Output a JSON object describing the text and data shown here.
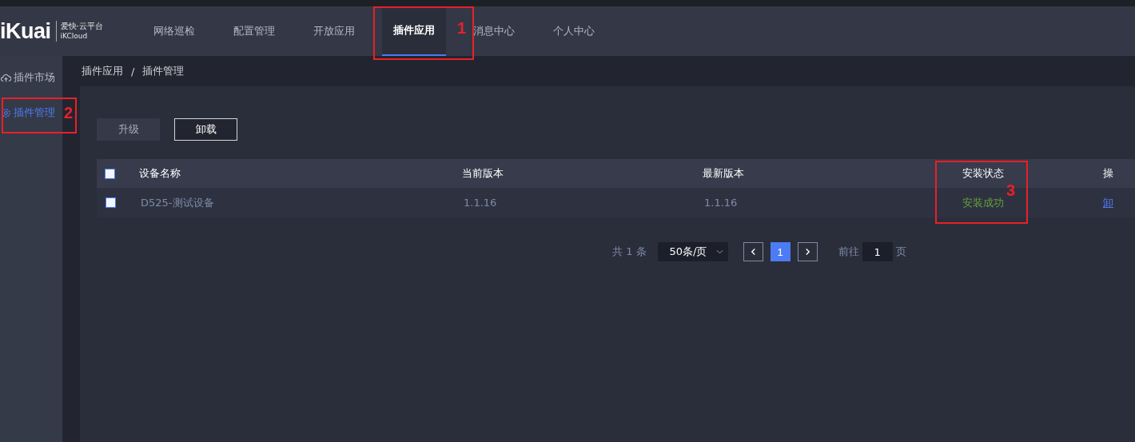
{
  "logo": {
    "brand": "iKuai",
    "subtitle": "爱快·云平台",
    "sub_en": "iKCloud"
  },
  "nav": [
    {
      "label": "网络巡检",
      "selected": false
    },
    {
      "label": "配置管理",
      "selected": false
    },
    {
      "label": "开放应用",
      "selected": false
    },
    {
      "label": "插件应用",
      "selected": true
    },
    {
      "label": "消息中心",
      "selected": false
    },
    {
      "label": "个人中心",
      "selected": false
    }
  ],
  "sidebar": [
    {
      "label": "插件市场",
      "selected": false
    },
    {
      "label": "插件管理",
      "selected": true
    }
  ],
  "breadcrumb": [
    "插件应用",
    "插件管理"
  ],
  "breadcrumb_separator": "/",
  "actions": [
    {
      "label": "升级",
      "kind": "filled"
    },
    {
      "label": "卸载",
      "kind": "outline"
    }
  ],
  "table": {
    "select_all_checked": false,
    "columns": [
      "设备名称",
      "当前版本",
      "最新版本",
      "安装状态",
      "操"
    ],
    "rows": [
      {
        "checked": false,
        "name": "D525-测试设备",
        "current": "1.1.16",
        "latest": "1.1.16",
        "status": "安装成功",
        "action": "卸"
      }
    ]
  },
  "pagination": {
    "total": "共 1 条",
    "page_size": "50条/页",
    "pages": [
      {
        "label": "1",
        "selected": true
      }
    ],
    "goto_label": "前往",
    "goto_value": "1",
    "page_suffix": "页"
  },
  "annotations": [
    {
      "label": "1"
    },
    {
      "label": "2"
    },
    {
      "label": "3"
    }
  ]
}
